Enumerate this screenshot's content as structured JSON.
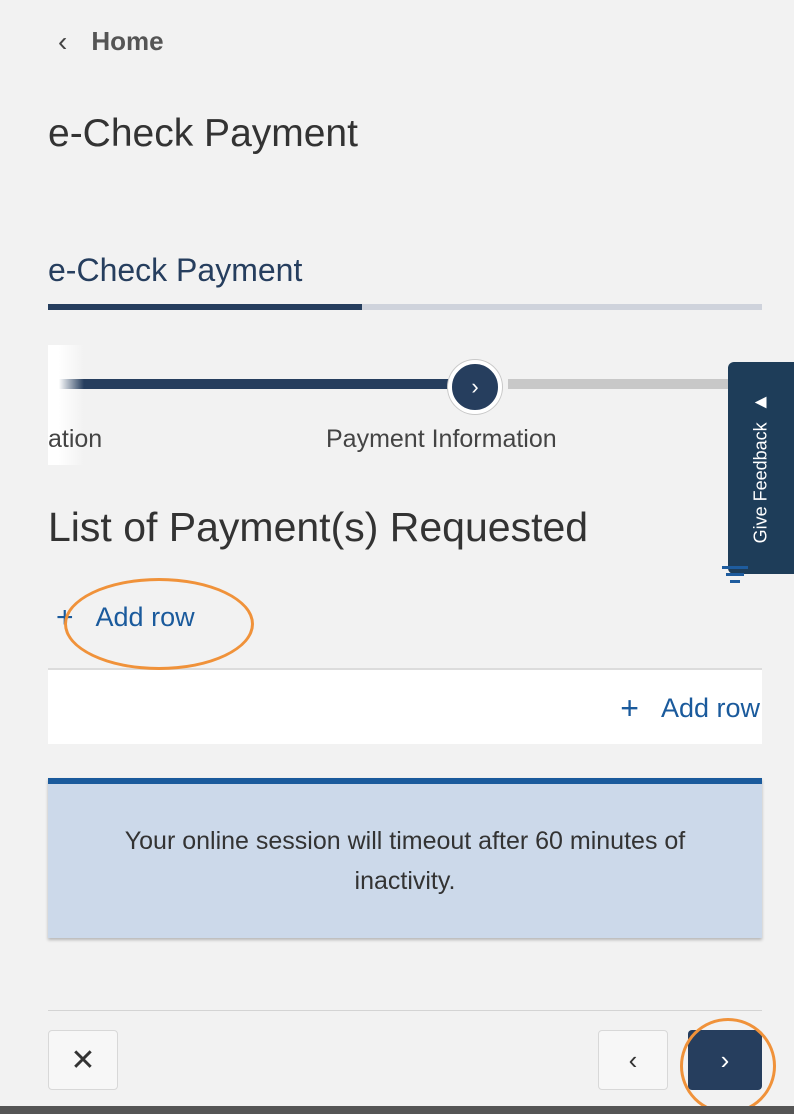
{
  "nav": {
    "back_label": "Home"
  },
  "page": {
    "title": "e-Check Payment"
  },
  "section_tab": {
    "label": "e-Check Payment",
    "progress_percent": 44
  },
  "stepper": {
    "previous_step_label": "ation",
    "current_step_label": "Payment Information"
  },
  "feedback": {
    "label": "Give Feedback"
  },
  "list": {
    "heading": "List of Payment(s) Requested",
    "add_row_label": "Add row",
    "table_add_row_label": "Add row"
  },
  "notice": {
    "text": "Your online session will timeout after 60 minutes of inactivity."
  },
  "colors": {
    "primary": "#263e5e",
    "link": "#1a5a9c",
    "notice_bg": "#ccd9ea",
    "highlight": "#f0923a"
  },
  "icons": {
    "back": "chevron-left-icon",
    "step": "chevron-right-icon",
    "feedback": "megaphone-icon",
    "filter": "filter-icon",
    "add": "plus-icon",
    "close": "close-icon",
    "prev": "chevron-left-icon",
    "next": "chevron-right-icon"
  }
}
